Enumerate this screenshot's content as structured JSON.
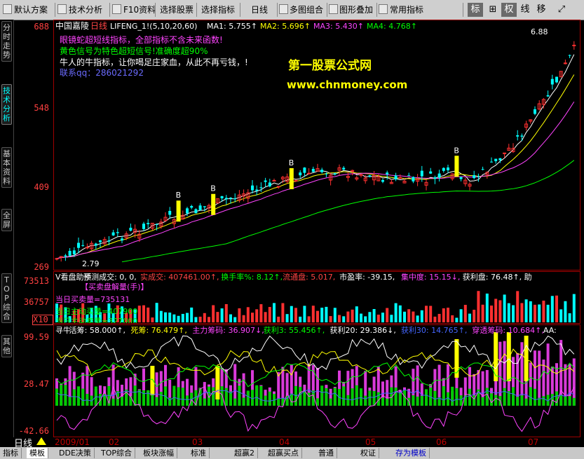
{
  "menubar": {
    "items": [
      "默认方案",
      "技术分析",
      "F10资料",
      "选择股票",
      "选择指标",
      "日线",
      "多图组合",
      "图形叠加",
      "常用指标"
    ],
    "right_buttons": [
      "标",
      "⊞",
      "权",
      "线",
      "移",
      "⤢"
    ]
  },
  "left_tabs": [
    "分时走势",
    "技术分析",
    "基本资料",
    "全屏",
    "TOP综合",
    "其他"
  ],
  "price_panel": {
    "stock_name": "中国嘉陵",
    "period": "日线",
    "indicator": "LIFENG_1!(5,10,20,60)",
    "ma": [
      {
        "label": "MA1:",
        "value": "5.755↑",
        "color": "#ffffff"
      },
      {
        "label": "MA2:",
        "value": "5.696↑",
        "color": "#ffff00"
      },
      {
        "label": "MA3:",
        "value": "5.430↑",
        "color": "#ff44ff"
      },
      {
        "label": "MA4:",
        "value": "4.768↑",
        "color": "#00ff00"
      }
    ],
    "y_ticks": [
      "688",
      "548",
      "409",
      "269"
    ],
    "notes": [
      {
        "text": "眼镜蛇超短线指标，全部指标不含未来函数!",
        "color": "#ff44ff"
      },
      {
        "text": "黄色信号为特色超短信号!准确度超90%",
        "color": "#00ff00"
      },
      {
        "text": "牛人的牛指标，让你喝足庄家血，从此不再亏钱，!",
        "color": "#ffffff"
      },
      {
        "text": "联系qq：286021292",
        "color": "#6b6bff"
      }
    ],
    "watermark_title": "第一股票公式网",
    "watermark_url": "www.chnmoney.com",
    "high_label": "6.88",
    "low_label": "2.79",
    "signal_label": "B"
  },
  "volume_panel": {
    "header": [
      {
        "text": "V看盘助手",
        "color": "#ffffff"
      },
      {
        "text": "预测成交: 0, 0,",
        "color": "#ffffff"
      },
      {
        "text": "实成交: 407461.00↑,",
        "color": "#ff4444"
      },
      {
        "text": "换手率%: 8.12↑,",
        "color": "#00ff00"
      },
      {
        "text": "流通盘: 5.017,",
        "color": "#ff4444"
      },
      {
        "text": "市盈率: -39.15,",
        "color": "#ffffff"
      },
      {
        "text": "集中度: 15.15↓,",
        "color": "#ff44ff"
      },
      {
        "text": "获利盘: 76.48↑,",
        "color": "#ffffff"
      },
      {
        "text": "助",
        "color": "#ffffff"
      }
    ],
    "y_ticks": [
      "73513",
      "36757"
    ],
    "unit_label": "X10",
    "sub_title": "【买卖盘解量(手)】",
    "line1": "当日买卖量=735131",
    "line2": "当日主动买量=407900",
    "line3": "当日主动卖量=327000"
  },
  "chip_panel": {
    "header": [
      {
        "text": "寻牛",
        "color": "#ffffff"
      },
      {
        "text": "活筹: 58.000↑,",
        "color": "#ffffff"
      },
      {
        "text": "死筹: 76.479↑,",
        "color": "#ffff00"
      },
      {
        "text": "主力筹码: 36.907↓,",
        "color": "#ff44ff"
      },
      {
        "text": "获利3: 55.456↑,",
        "color": "#00ff00"
      },
      {
        "text": "获利20: 29.386↓,",
        "color": "#ffffff"
      },
      {
        "text": "获利30: 14.765↑,",
        "color": "#4466ff"
      },
      {
        "text": "穿透筹码: 10.684↑,",
        "color": "#ff44ff"
      },
      {
        "text": "AA:",
        "color": "#ffffff"
      }
    ],
    "y_ticks": [
      "99.59",
      "28.47",
      "-42.66"
    ]
  },
  "date_axis": {
    "period_label": "日线",
    "labels": [
      "2009/01",
      "02",
      "03",
      "04",
      "05",
      "06",
      "07"
    ]
  },
  "bottom_tabs": [
    "指标",
    "模板",
    "DDE决策",
    "TOP综合",
    "板块涨幅",
    "标准",
    "超赢2",
    "超赢买点",
    "普通",
    "权证",
    "存为模板"
  ]
}
